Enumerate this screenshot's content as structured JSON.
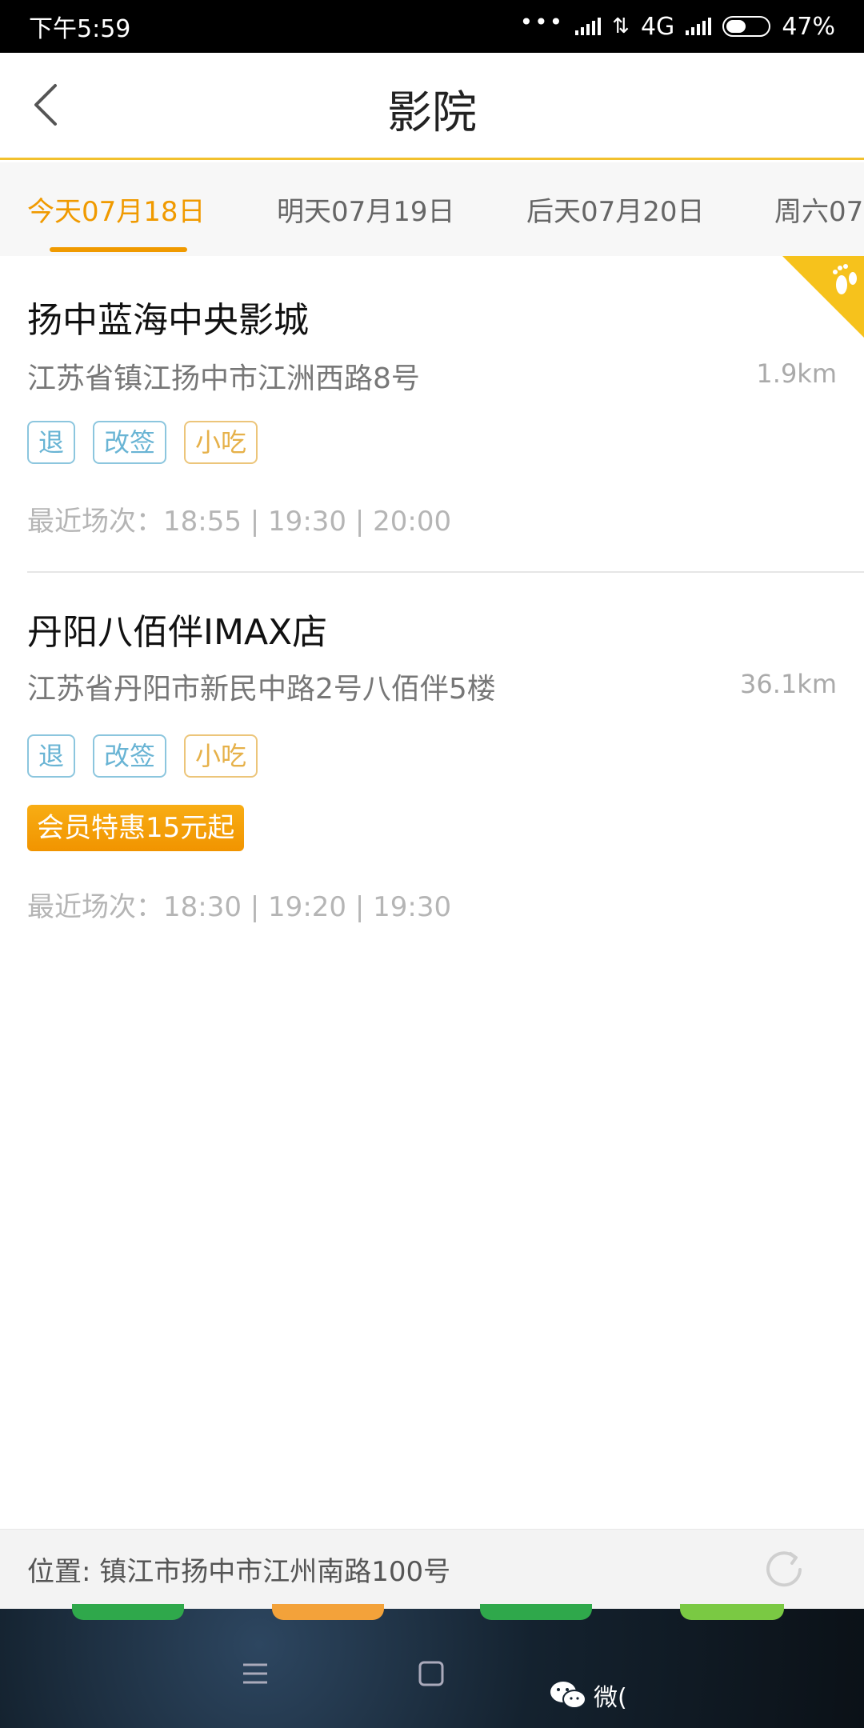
{
  "status_bar": {
    "time": "下午5:59",
    "dots": "•••",
    "network": "4G",
    "battery": "47%"
  },
  "header": {
    "title": "影院",
    "back_icon": "back-arrow-icon"
  },
  "date_tabs": [
    {
      "label": "今天07月18日",
      "active": true
    },
    {
      "label": "明天07月19日",
      "active": false
    },
    {
      "label": "后天07月20日",
      "active": false
    },
    {
      "label": "周六07",
      "active": false
    }
  ],
  "cinemas": [
    {
      "name": "扬中蓝海中央影城",
      "address": "江苏省镇江扬中市江洲西路8号",
      "distance": "1.9km",
      "tags": [
        "退",
        "改签",
        "小吃"
      ],
      "member_offer": "",
      "showtimes": "最近场次：18:55 | 19:30 | 20:00",
      "visited_flag": "footprint-icon"
    },
    {
      "name": "丹阳八佰伴IMAX店",
      "address": "江苏省丹阳市新民中路2号八佰伴5楼",
      "distance": "36.1km",
      "tags": [
        "退",
        "改签",
        "小吃"
      ],
      "member_offer": "会员特惠15元起",
      "showtimes": "最近场次：18:30 | 19:20 | 19:30"
    }
  ],
  "location_bar": {
    "text": "位置: 镇江市扬中市江州南路100号",
    "refresh_icon": "refresh-icon"
  },
  "nav_bar": {
    "watermark": "微(",
    "icons": [
      "menu-icon",
      "home-square-icon",
      "back-check-icon",
      "wechat-icon"
    ]
  },
  "colors": {
    "accent": "#f09a00",
    "header_line": "#f2c12e",
    "tag_blue": "#69b4d4",
    "tag_orange": "#e6b14a"
  }
}
